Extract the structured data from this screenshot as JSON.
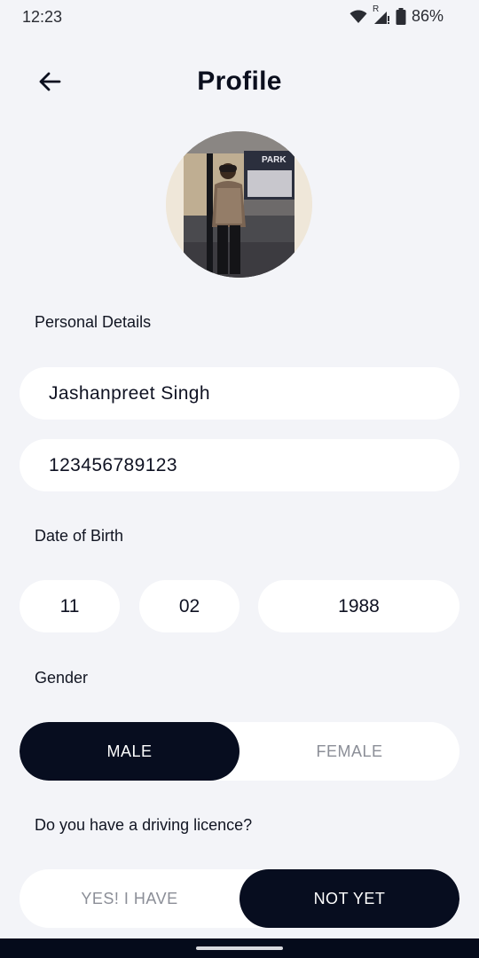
{
  "status_bar": {
    "time": "12:23",
    "roaming_indicator": "R",
    "battery_percent": "86%",
    "icons": [
      "wifi-icon",
      "signal-icon",
      "battery-icon"
    ]
  },
  "header": {
    "back_icon": "arrow-left-icon",
    "title": "Profile"
  },
  "avatar": {
    "sign_text": "PARK"
  },
  "personal_details": {
    "label": "Personal Details",
    "name_value": "Jashanpreet Singh",
    "phone_value": "123456789123"
  },
  "date_of_birth": {
    "label": "Date of Birth",
    "day": "11",
    "month": "02",
    "year": "1988"
  },
  "gender": {
    "label": "Gender",
    "options": [
      "MALE",
      "FEMALE"
    ],
    "selected": "MALE"
  },
  "licence": {
    "label": "Do you have a driving licence?",
    "options": [
      "YES! I HAVE",
      "NOT YET"
    ],
    "selected": "NOT YET"
  },
  "colors": {
    "background": "#f3f4f8",
    "accent_dark": "#070d1f",
    "field_bg": "#ffffff",
    "inactive_text": "#8b8e97"
  }
}
